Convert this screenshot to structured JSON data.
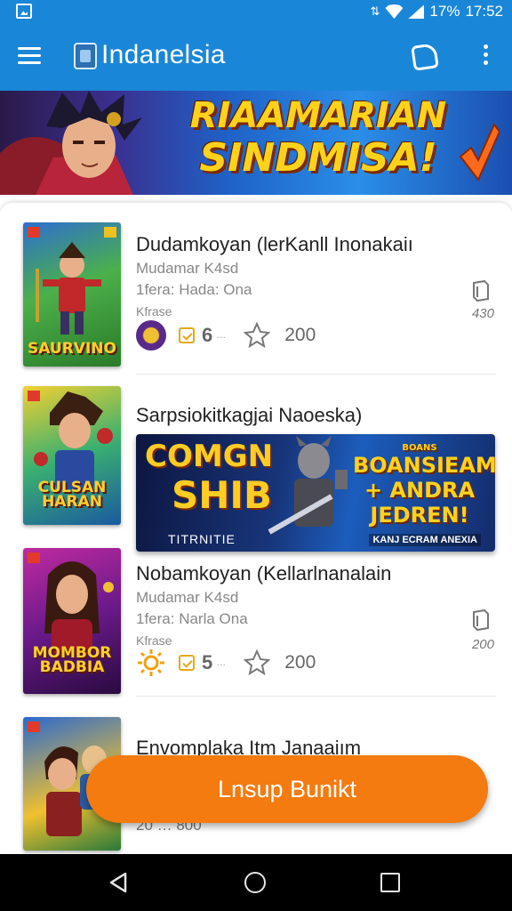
{
  "status_bar": {
    "battery": "17%",
    "time": "17:52"
  },
  "app_bar": {
    "title": "Indanelsia"
  },
  "banner": {
    "line1": "RIAAMARIAN",
    "line2": "SINDMISA!"
  },
  "items": [
    {
      "title": "Dudamkoyan (lerKanll Inonakaiı",
      "meta1": "Mudamar K4sd",
      "meta2": "1fera: Hada: Ona",
      "meta3": "Kfrase",
      "rank": "6",
      "rank_suffix": "…",
      "count": "200",
      "side_value": "430",
      "cover_label": "SAURVINO"
    },
    {
      "title": "Sarpsiokitkagjai Naoeska)",
      "cover_label": "CULSAN HARAN",
      "promo": {
        "left1": "COMGN",
        "left2": "SHIB",
        "right0": "BOANS",
        "right1": "BOANSIEAM",
        "right2": "+ ANDRA",
        "right3": "JEDREN!",
        "bottom_left": "TITRNITIE",
        "bottom_right": "KANJ ECRAM ANEXIA"
      }
    },
    {
      "title": "Nobamkoyan (Kellarlnanalain",
      "meta1": "Mudamar K4sd",
      "meta2": "1fera: Narla Ona",
      "meta3": "Kfrase",
      "rank": "5",
      "rank_suffix": "…",
      "count": "200",
      "side_value": "200",
      "cover_label": "MOMBOR BADBIA"
    },
    {
      "title": "Envomplaka Itm Janaaiım",
      "meta_partial": "20 …   800"
    }
  ],
  "fab": {
    "label": "Lnsup Bunikt"
  },
  "colors": {
    "primary": "#1a86d8",
    "accent": "#f47b10"
  }
}
